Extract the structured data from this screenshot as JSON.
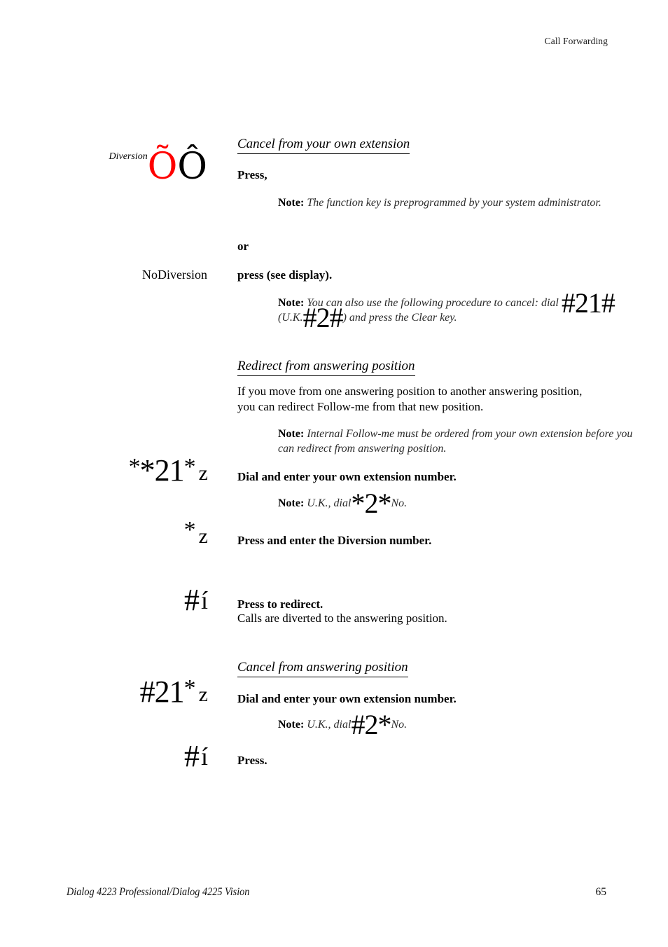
{
  "running_head": "Call Forwarding",
  "footer": {
    "title": "Dialog 4223 Professional/Dialog 4225 Vision",
    "page_number": "65"
  },
  "colors": {
    "key_highlight": "#ff0000",
    "text": "#000000"
  },
  "sections": [
    {
      "id": "cancel-own-extension",
      "heading": "Cancel from your own extension",
      "key_label": "Diversion",
      "key_glyph_red": "Õ",
      "key_glyph_black": "Ô",
      "instruction": "Press,",
      "note_label": "Note:",
      "note_text": "The function key is preprogrammed by your system administrator.",
      "alternative_word": "or",
      "alt_key_label": "NoDiversion",
      "alt_instruction": "press (see display).",
      "alt_note_label": "Note:",
      "alt_note_part1": "You can also use the following procedure to cancel: dial",
      "alt_note_code1": "#21#",
      "alt_note_part2": "(U.K.",
      "alt_note_code2": "#2#",
      "alt_note_part3": ") and press the Clear key."
    },
    {
      "id": "redirect-answering-position",
      "heading": "Redirect from answering position",
      "body": "If you move from one answering position to another answering position, you can redirect Follow-me from that new position.",
      "note_label": "Note:",
      "note_text": "Internal Follow-me must be ordered from your own extension before you can redirect from answering position.",
      "steps": [
        {
          "code_prefix": "*21",
          "code_star": "*",
          "code_entry": "z",
          "instruction": "Dial and enter your own extension number.",
          "note_label": "Note:",
          "note_pre": "U.K., dial",
          "note_code": "*2*",
          "note_post": "No."
        },
        {
          "code_prefix": "",
          "code_star": "*",
          "code_entry": "z",
          "instruction": "Press and enter the Diversion number."
        },
        {
          "code_prefix": "#",
          "code_entry_accent": "í",
          "instruction": "Press to redirect.",
          "subtext": "Calls are diverted to the answering position."
        }
      ]
    },
    {
      "id": "cancel-answering-position",
      "heading": "Cancel from answering position",
      "steps": [
        {
          "code_prefix": "#21",
          "code_star": "*",
          "code_entry": "z",
          "instruction": "Dial and enter your own extension number.",
          "note_label": "Note:",
          "note_pre": "U.K., dial",
          "note_code": "#2*",
          "note_post": "No."
        },
        {
          "code_prefix": "#",
          "code_entry_accent": "í",
          "instruction": "Press."
        }
      ]
    }
  ]
}
